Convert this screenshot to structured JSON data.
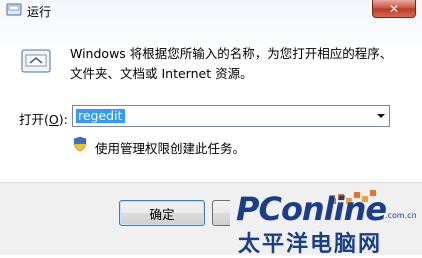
{
  "window": {
    "title": "运行",
    "close_label": "✕"
  },
  "description": {
    "line1": "Windows 将根据您所输入的名称，为您打开相应的程序、",
    "line2": "文件夹、文档或 Internet 资源。"
  },
  "open_field": {
    "label_prefix": "打开(",
    "label_hotkey": "O",
    "label_suffix": "):",
    "value": "regedit"
  },
  "admin_note": "使用管理权限创建此任务。",
  "buttons": {
    "ok_label": "确定"
  },
  "watermark": {
    "brand": "PConline",
    "domain": ".com.cn",
    "cn": "太平洋电脑网"
  },
  "colors": {
    "selection": "#3399ff",
    "brand": "#1a3e8c",
    "close": "#c7503a"
  }
}
